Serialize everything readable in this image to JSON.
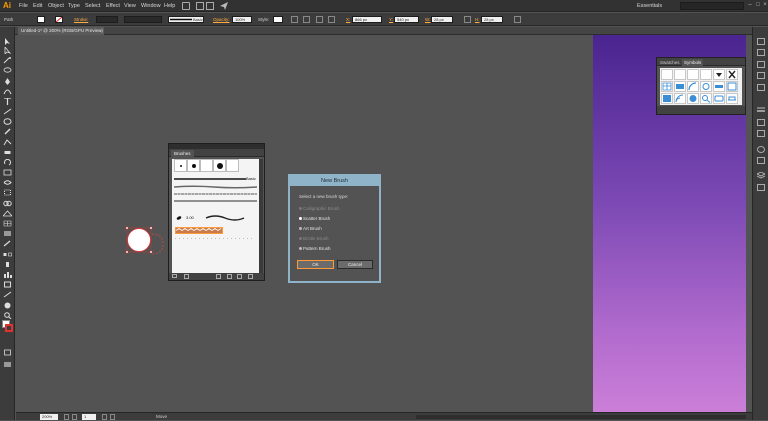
{
  "app": {
    "logo": "Ai",
    "workspace": "Essentials"
  },
  "menus": [
    "File",
    "Edit",
    "Object",
    "Type",
    "Select",
    "Effect",
    "View",
    "Window",
    "Help"
  ],
  "control_bar": {
    "selection_label": "Path",
    "stroke_label": "Stroke:",
    "brush_name": "Basic",
    "opacity_label": "Opacity:",
    "opacity_value": "100%",
    "style_label": "Style:",
    "x_label": "X:",
    "x_value": "866 px",
    "y_label": "Y:",
    "y_value": "540 px",
    "w_label": "W:",
    "w_value": "28 px",
    "h_label": "H:",
    "h_value": "28 px"
  },
  "document_tab": {
    "label": "Untitled-1* @ 200% (RGB/GPU Preview)",
    "close": "×"
  },
  "brushes_panel": {
    "tab": "Brushes",
    "basic_label": "Basic",
    "art_size": "3.00"
  },
  "symbols_panel": {
    "tabs": [
      "Swatches",
      "Symbols"
    ],
    "active_tab": "Symbols"
  },
  "dialog": {
    "title": "New Brush",
    "prompt": "Select a new brush type:",
    "options": [
      {
        "label": "Calligraphic Brush",
        "enabled": false,
        "selected": false
      },
      {
        "label": "Scatter Brush",
        "enabled": true,
        "selected": true
      },
      {
        "label": "Art Brush",
        "enabled": true,
        "selected": false
      },
      {
        "label": "Bristle Brush",
        "enabled": false,
        "selected": false
      },
      {
        "label": "Pattern Brush",
        "enabled": true,
        "selected": false
      }
    ],
    "ok": "OK",
    "cancel": "Cancel"
  },
  "status_bar": {
    "zoom": "200%",
    "page": "1",
    "tool": "Move"
  },
  "colors": {
    "accent": "#ff9a00",
    "dialog_title": "#8fb3c8",
    "gradient_top": "#4a2490",
    "gradient_bottom": "#cb7fd8"
  }
}
